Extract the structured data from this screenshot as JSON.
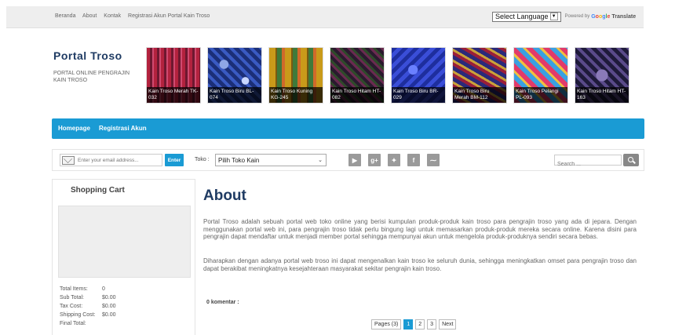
{
  "topnav": {
    "items": [
      "Beranda",
      "About",
      "Kontak",
      "Registrasi Akun Portal Kain Troso"
    ]
  },
  "language": {
    "selected": "Select Language",
    "powered_by": "Powered by",
    "google": "Google",
    "translate": "Translate"
  },
  "brand": {
    "title": "Portal Troso",
    "subtitle": "PORTAL ONLINE PENGRAJIN KAIN TROSO"
  },
  "products": [
    {
      "caption": "Kain Troso Merah TK-032"
    },
    {
      "caption": "Kain Troso Biru BL-074"
    },
    {
      "caption": "Kain Troso Kuning KG-245"
    },
    {
      "caption": "Kain Troso Hitam HT-082"
    },
    {
      "caption": "Kain Troso Biru BR-029"
    },
    {
      "caption": "Kain Troso Biru Merah BM-112"
    },
    {
      "caption": "Kain Troso Pelangi PL-093"
    },
    {
      "caption": "Kain Troso Hitam HT-163"
    }
  ],
  "mainnav": {
    "items": [
      "Homepage",
      "Registrasi Akun"
    ]
  },
  "toolbar": {
    "email_placeholder": "Enter your email address...",
    "enter_label": "Enter",
    "toko_label": "Toko :",
    "toko_selected": "Pilih Toko Kain",
    "search_placeholder": "Search ...",
    "social_icons": [
      "youtube-icon",
      "google-plus-icon",
      "twitter-icon",
      "facebook-icon",
      "rss-icon"
    ]
  },
  "cart": {
    "title": "Shopping Cart",
    "rows": [
      {
        "label": "Total Items:",
        "value": "0"
      },
      {
        "label": "Sub Total:",
        "value": "$0.00"
      },
      {
        "label": "Tax Cost:",
        "value": "$0.00"
      },
      {
        "label": "Shipping Cost:",
        "value": "$0.00"
      },
      {
        "label": "Final Total:",
        "value": ""
      }
    ]
  },
  "article": {
    "title": "About",
    "para1": "Portal Troso adalah sebuah portal web toko online yang berisi kumpulan produk-produk kain troso para pengrajin troso yang ada di jepara. Dengan menggunakan portal web ini, para pengrajin troso tidak perlu bingung lagi untuk memasarkan produk-produk mereka secara online. Karena disini para pengrajin dapat mendaftar untuk menjadi member portal sehingga mempunyai akun untuk mengelola produk-produknya sendiri secara bebas.",
    "para2": "Diharapkan dengan adanya portal web troso ini dapat mengenalkan kain troso ke seluruh dunia, sehingga meningkatkan omset para pengrajin troso dan dapat berakibat meningkatnya kesejahteraan masyarakat sekitar pengrajin kain troso.",
    "comments": "0 komentar :"
  },
  "pager": {
    "label": "Pages (3)",
    "pages": [
      "1",
      "2",
      "3"
    ],
    "next": "Next"
  },
  "colors": {
    "accent": "#1a9bd4",
    "title": "#1f3b63"
  }
}
